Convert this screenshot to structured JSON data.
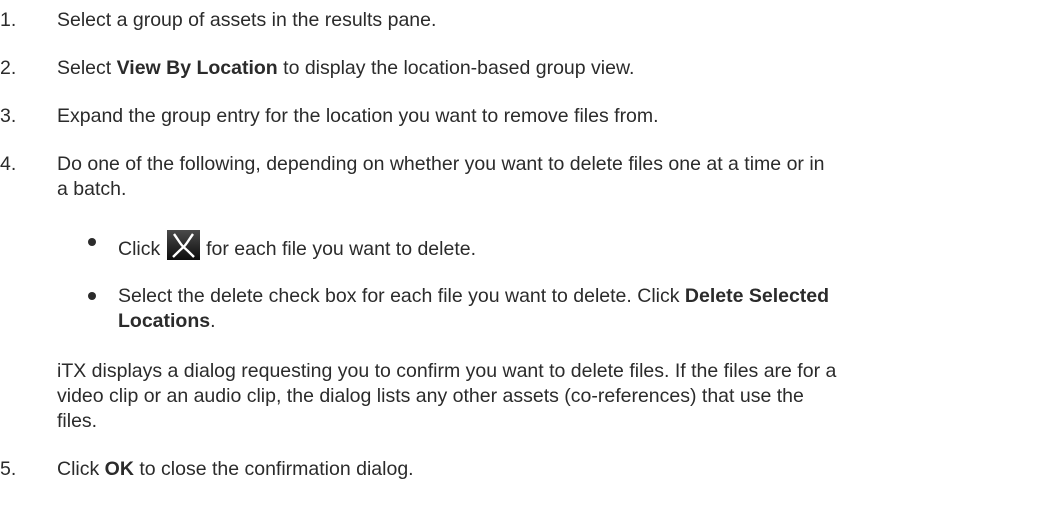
{
  "steps": [
    {
      "num": "1.",
      "text": "Select a group of assets in the results pane."
    },
    {
      "num": "2.",
      "pre": "Select ",
      "bold": "View By Location",
      "post": " to display the location-based group view."
    },
    {
      "num": "3.",
      "text": "Expand the group entry for the location you want to remove files from."
    },
    {
      "num": "4.",
      "line1": "Do one of the following, depending on whether you want to delete files one at a time or in",
      "line2": "a batch."
    },
    {
      "num": "5.",
      "pre": "Click ",
      "bold": "OK",
      "post": " to close the confirmation dialog."
    }
  ],
  "bullets": [
    {
      "pre": "Click",
      "post": "for each file you want to delete.",
      "icon": "delete-x-icon"
    },
    {
      "line1": "Select the delete check box for each file you want to delete. Click ",
      "bold1": "Delete Selected",
      "bold2": "Locations",
      "post2": "."
    }
  ],
  "note": {
    "line1": "iTX displays a dialog requesting you to confirm you want to delete files. If the files are for a",
    "line2": "video clip or an audio clip, the dialog lists any other assets (co-references) that use the",
    "line3": "files."
  },
  "colors": {
    "text": "#2b2b2b",
    "icon_bg": "#1a1a1a",
    "icon_fg": "#ffffff"
  }
}
